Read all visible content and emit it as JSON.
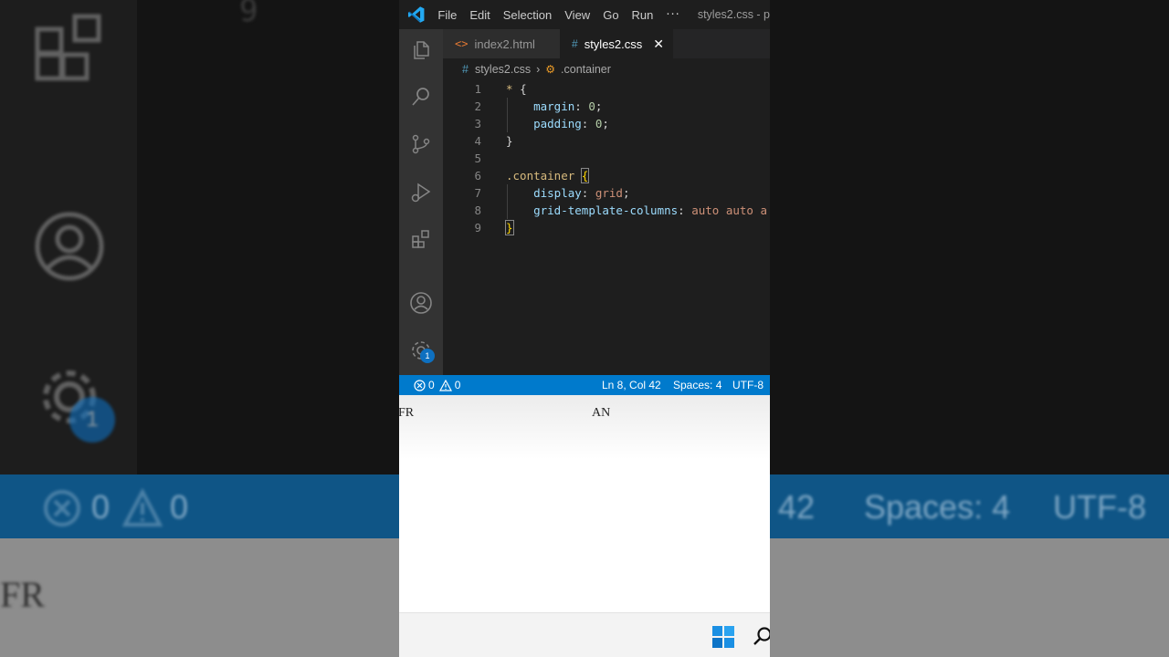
{
  "window_title": "styles2.css - p",
  "menu": [
    "File",
    "Edit",
    "Selection",
    "View",
    "Go",
    "Run"
  ],
  "menu_more": "···",
  "tabs": [
    {
      "label": "index2.html",
      "icon": "html-file-icon",
      "active": false
    },
    {
      "label": "styles2.css",
      "icon": "css-file-icon",
      "active": true
    }
  ],
  "breadcrumb": {
    "file": "styles2.css",
    "symbol": ".container"
  },
  "code_lines": [
    {
      "n": "1",
      "tokens": [
        [
          "c-sel",
          "* "
        ],
        [
          "c-punc",
          "{"
        ]
      ]
    },
    {
      "n": "2",
      "tokens": [
        [
          "c-punc",
          "    "
        ],
        [
          "c-prop",
          "margin"
        ],
        [
          "c-punc",
          ": "
        ],
        [
          "c-num",
          "0"
        ],
        [
          "c-punc",
          ";"
        ]
      ]
    },
    {
      "n": "3",
      "tokens": [
        [
          "c-punc",
          "    "
        ],
        [
          "c-prop",
          "padding"
        ],
        [
          "c-punc",
          ": "
        ],
        [
          "c-num",
          "0"
        ],
        [
          "c-punc",
          ";"
        ]
      ]
    },
    {
      "n": "4",
      "tokens": [
        [
          "c-punc",
          "}"
        ]
      ]
    },
    {
      "n": "5",
      "tokens": []
    },
    {
      "n": "6",
      "tokens": [
        [
          "c-sel",
          ".container"
        ],
        [
          "c-punc",
          " "
        ],
        [
          "c-brace-hl",
          "{"
        ]
      ]
    },
    {
      "n": "7",
      "tokens": [
        [
          "c-punc",
          "    "
        ],
        [
          "c-prop",
          "display"
        ],
        [
          "c-punc",
          ": "
        ],
        [
          "c-val",
          "grid"
        ],
        [
          "c-punc",
          ";"
        ]
      ]
    },
    {
      "n": "8",
      "tokens": [
        [
          "c-punc",
          "    "
        ],
        [
          "c-prop",
          "grid-template-columns"
        ],
        [
          "c-punc",
          ": "
        ],
        [
          "c-val",
          "auto auto a"
        ]
      ]
    },
    {
      "n": "9",
      "tokens": [
        [
          "c-brace-hl",
          "}"
        ]
      ]
    }
  ],
  "status": {
    "errors": "0",
    "warnings": "0",
    "position": "Ln 8, Col 42",
    "spaces": "Spaces: 4",
    "encoding": "UTF-8"
  },
  "browser_text": [
    "FR",
    "AN"
  ],
  "activity_badge": "1",
  "background": {
    "top_fragment": "9",
    "status_errors": "0",
    "status_warnings": "0",
    "status_col": "42",
    "status_spaces": "Spaces: 4",
    "status_encoding": "UTF-8",
    "page_text": "FR",
    "badge": "1"
  }
}
